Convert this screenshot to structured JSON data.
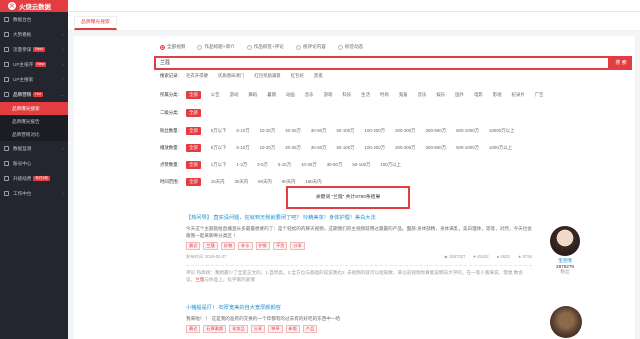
{
  "app": {
    "logo_mark": "火",
    "title": "火烧云数据"
  },
  "sidebar": {
    "items": [
      {
        "label": "数据台台"
      },
      {
        "label": "大势看板"
      },
      {
        "label": "流量参谋",
        "badge": "New"
      },
      {
        "label": "UP主排序",
        "badge": "New"
      },
      {
        "label": "UP主搜索"
      },
      {
        "label": "品牌营销",
        "badge": "Hot"
      }
    ],
    "subitems": [
      "品牌曝光搜索",
      "品牌曝光报告",
      "品牌营销对比"
    ],
    "items2": [
      {
        "label": "数据监测"
      },
      {
        "label": "账号中心"
      },
      {
        "label": "升级续费",
        "badge": "年付8折"
      },
      {
        "label": "工作中台"
      }
    ]
  },
  "tab": {
    "label": "品牌曝光搜索"
  },
  "search": {
    "modes": [
      "全部视频",
      "作品标题+简介",
      "作品标签+评论",
      "视评论内容",
      "标签动态"
    ],
    "value": "兰蔻",
    "button": "搜 索"
  },
  "filters": [
    {
      "label": "搜索记录:",
      "options": [
        "毛衣开得硬",
        "优质香味清门",
        "红包奖励满意",
        "红包好",
        "黑夜"
      ]
    },
    {
      "label": "所属分类:",
      "options": [
        "全部",
        "公告",
        "游动",
        "舞蹈",
        "暑期",
        "动画",
        "音乐",
        "游戏",
        "科技",
        "生活",
        "时尚",
        "鬼畜",
        "音乐",
        "娱乐",
        "国外",
        "电影",
        "影视",
        "纪录片",
        "广告"
      ]
    },
    {
      "label": "二级分类:",
      "options": [
        "全部"
      ]
    },
    {
      "label": "粉丝数量:",
      "options": [
        "全部",
        "5万以下",
        "5-10万",
        "10-20万",
        "20-30万",
        "30-50万",
        "50-100万",
        "100-200万",
        "200-300万",
        "300-500万",
        "500-1000万",
        "10000万以上"
      ]
    },
    {
      "label": "播放数量:",
      "options": [
        "全部",
        "5万以下",
        "5-10万",
        "10-20万",
        "20-30万",
        "30-50万",
        "50-100万",
        "100-200万",
        "200-300万",
        "300-500万",
        "500-1000万",
        "1000万以上"
      ]
    },
    {
      "label": "点赞数量:",
      "options": [
        "全部",
        "1万以下",
        "1-3万",
        "3-5万",
        "5-10万",
        "10-30万",
        "30-50万",
        "50-100万",
        "100万以上"
      ]
    },
    {
      "label": "时间范围:",
      "options": [
        "全部",
        "15天内",
        "30天内",
        "60天内",
        "90天内",
        "180天内"
      ]
    }
  ],
  "stats": {
    "prefix": "关键词 “兰蔻” 共计",
    "count": "8790",
    "suffix": "条结果"
  },
  "articles": [
    {
      "title_pre": "【热问导】 直实没问题，狂就到无我就要闭了吧？ 玲精美妆！身体护理！美白大法",
      "desc": "今天这个主题就给直播直长多最最想要的了：是个轻松的的聊天视频，这期我们的主视频就用过最最的产品。面部:身体部精，身体满乳，美白理体，等等，对然，今天也会跟我一起来聊养分类区 ！",
      "tags": [
        "最近",
        "兰蔻",
        "好物",
        "补水",
        "护肤",
        "干货",
        "分享"
      ],
      "date": "发布时间: 2019-02-27",
      "stats": [
        "2657327",
        "45432",
        "2633",
        "5734"
      ],
      "comment_pre": "评论 热高榜：我想最少了全是正文的，1.自然高，2.全方位与基础的说说我也2. 去视频的就可以给知数，某以前视频你真能说明白大学的，在一等人看来说，需想 数会议。",
      "comment_hl": "兰蔻",
      "comment_post": "与你品上，化学家的爱情",
      "author_name": "宝兜嘿",
      "author_fans": "2879279",
      "author_role": "粉丝"
    },
    {
      "title_pre": "小猪船是打！ 石厚宽美的自大宽厚颜颜容",
      "desc": "我来啦！ ！ 这是我的准有的交换的一个年都有的过去有的好吃的东西中一哈",
      "tags": [
        "最近",
        "石厚素颜",
        "化妆品",
        "分享",
        "种草",
        "新版",
        "产品"
      ],
      "date": "",
      "stats": [],
      "comment_pre": "",
      "comment_hl": "",
      "comment_post": "",
      "author_name": "",
      "author_fans": "",
      "author_role": ""
    }
  ]
}
